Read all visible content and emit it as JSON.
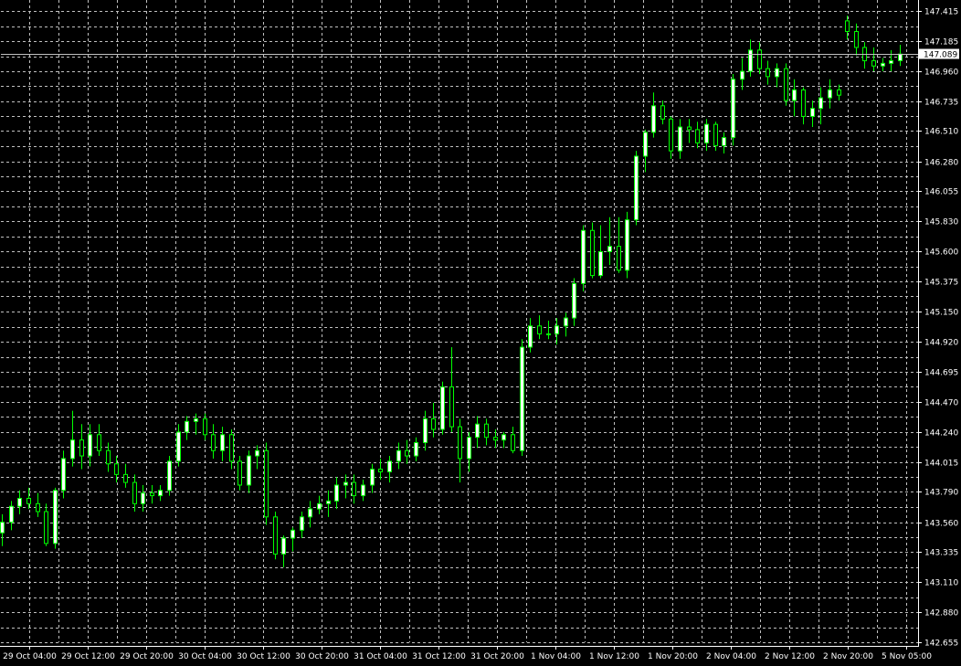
{
  "chart_data": {
    "type": "candlestick",
    "current_price_label": "147.089",
    "current_price": 147.089,
    "ylim": [
      142.655,
      147.415
    ],
    "y_ticks": [
      "147.415",
      "147.185",
      "146.960",
      "146.735",
      "146.510",
      "146.280",
      "146.055",
      "145.830",
      "145.600",
      "145.375",
      "145.150",
      "144.920",
      "144.695",
      "144.470",
      "144.240",
      "144.015",
      "143.790",
      "143.560",
      "143.335",
      "143.110",
      "142.880",
      "142.655"
    ],
    "x_ticks": [
      "29 Oct 04:00",
      "29 Oct 12:00",
      "29 Oct 20:00",
      "30 Oct 04:00",
      "30 Oct 12:00",
      "30 Oct 20:00",
      "31 Oct 04:00",
      "31 Oct 12:00",
      "31 Oct 20:00",
      "1 Nov 04:00",
      "1 Nov 12:00",
      "1 Nov 20:00",
      "2 Nov 04:00",
      "2 Nov 12:00",
      "2 Nov 20:00",
      "5 Nov 05:00"
    ],
    "colors": {
      "bull": "#ffffff",
      "bear": "#000000",
      "wick": "#00ff00",
      "grid": "#c0c0c0",
      "axis": "#ffffff",
      "price_line": "#c0c0c0"
    },
    "grid": true,
    "ohlc": [
      [
        143.48,
        143.62,
        143.38,
        143.56
      ],
      [
        143.56,
        143.72,
        143.5,
        143.68
      ],
      [
        143.68,
        143.8,
        143.62,
        143.74
      ],
      [
        143.74,
        143.82,
        143.66,
        143.7
      ],
      [
        143.7,
        143.78,
        143.6,
        143.64
      ],
      [
        143.64,
        143.7,
        143.38,
        143.4
      ],
      [
        143.4,
        143.82,
        143.36,
        143.8
      ],
      [
        143.8,
        144.1,
        143.74,
        144.04
      ],
      [
        144.04,
        144.4,
        143.98,
        144.18
      ],
      [
        144.18,
        144.3,
        143.96,
        144.06
      ],
      [
        144.06,
        144.3,
        143.98,
        144.22
      ],
      [
        144.22,
        144.3,
        144.06,
        144.1
      ],
      [
        144.1,
        144.16,
        143.94,
        144.0
      ],
      [
        144.0,
        144.06,
        143.86,
        143.92
      ],
      [
        143.92,
        144.0,
        143.82,
        143.86
      ],
      [
        143.86,
        143.92,
        143.64,
        143.7
      ],
      [
        143.7,
        143.84,
        143.64,
        143.78
      ],
      [
        143.78,
        143.84,
        143.7,
        143.76
      ],
      [
        143.76,
        143.84,
        143.72,
        143.8
      ],
      [
        143.8,
        144.06,
        143.76,
        144.02
      ],
      [
        144.02,
        144.3,
        143.98,
        144.24
      ],
      [
        144.24,
        144.36,
        144.18,
        144.32
      ],
      [
        144.32,
        144.38,
        144.22,
        144.34
      ],
      [
        144.34,
        144.38,
        144.18,
        144.22
      ],
      [
        144.22,
        144.3,
        144.04,
        144.1
      ],
      [
        144.1,
        144.28,
        144.02,
        144.22
      ],
      [
        144.22,
        144.26,
        143.96,
        144.02
      ],
      [
        144.02,
        144.06,
        143.8,
        143.84
      ],
      [
        143.84,
        144.1,
        143.78,
        144.06
      ],
      [
        144.06,
        144.14,
        143.96,
        144.1
      ],
      [
        144.1,
        144.16,
        143.54,
        143.6
      ],
      [
        143.6,
        143.64,
        143.28,
        143.32
      ],
      [
        143.32,
        143.46,
        143.22,
        143.44
      ],
      [
        143.44,
        143.52,
        143.34,
        143.5
      ],
      [
        143.5,
        143.64,
        143.44,
        143.6
      ],
      [
        143.6,
        143.72,
        143.52,
        143.66
      ],
      [
        143.66,
        143.76,
        143.62,
        143.7
      ],
      [
        143.7,
        143.8,
        143.6,
        143.72
      ],
      [
        143.72,
        143.9,
        143.66,
        143.84
      ],
      [
        143.84,
        143.92,
        143.74,
        143.86
      ],
      [
        143.86,
        143.92,
        143.7,
        143.76
      ],
      [
        143.76,
        143.88,
        143.72,
        143.84
      ],
      [
        143.84,
        144.0,
        143.78,
        143.96
      ],
      [
        143.96,
        144.04,
        143.88,
        143.94
      ],
      [
        143.94,
        144.06,
        143.86,
        144.02
      ],
      [
        144.02,
        144.16,
        143.96,
        144.1
      ],
      [
        144.1,
        144.18,
        144.0,
        144.06
      ],
      [
        144.06,
        144.2,
        144.02,
        144.16
      ],
      [
        144.16,
        144.4,
        144.1,
        144.34
      ],
      [
        144.34,
        144.46,
        144.2,
        144.26
      ],
      [
        144.26,
        144.62,
        144.22,
        144.58
      ],
      [
        144.58,
        144.88,
        144.24,
        144.28
      ],
      [
        144.28,
        144.34,
        143.86,
        144.04
      ],
      [
        144.04,
        144.24,
        143.94,
        144.2
      ],
      [
        144.2,
        144.36,
        144.12,
        144.3
      ],
      [
        144.3,
        144.34,
        144.14,
        144.2
      ],
      [
        144.2,
        144.26,
        144.12,
        144.18
      ],
      [
        144.18,
        144.24,
        144.12,
        144.22
      ],
      [
        144.22,
        144.28,
        144.08,
        144.1
      ],
      [
        144.1,
        144.94,
        144.06,
        144.88
      ],
      [
        144.88,
        145.1,
        144.84,
        145.04
      ],
      [
        145.04,
        145.12,
        144.94,
        144.98
      ],
      [
        144.98,
        145.08,
        144.94,
        144.98
      ],
      [
        144.98,
        145.1,
        144.9,
        145.04
      ],
      [
        145.04,
        145.14,
        144.96,
        145.1
      ],
      [
        145.1,
        145.4,
        145.04,
        145.36
      ],
      [
        145.36,
        145.8,
        145.3,
        145.76
      ],
      [
        145.76,
        145.82,
        145.4,
        145.42
      ],
      [
        145.42,
        145.8,
        145.4,
        145.6
      ],
      [
        145.6,
        145.86,
        145.5,
        145.64
      ],
      [
        145.64,
        145.86,
        145.44,
        145.46
      ],
      [
        145.46,
        145.9,
        145.4,
        145.84
      ],
      [
        145.84,
        146.36,
        145.8,
        146.32
      ],
      [
        146.32,
        146.52,
        146.2,
        146.5
      ],
      [
        146.5,
        146.8,
        146.46,
        146.7
      ],
      [
        146.7,
        146.74,
        146.56,
        146.6
      ],
      [
        146.6,
        146.62,
        146.3,
        146.36
      ],
      [
        146.36,
        146.6,
        146.3,
        146.54
      ],
      [
        146.54,
        146.6,
        146.42,
        146.52
      ],
      [
        146.52,
        146.58,
        146.38,
        146.42
      ],
      [
        146.42,
        146.6,
        146.36,
        146.56
      ],
      [
        146.56,
        146.58,
        146.36,
        146.4
      ],
      [
        146.4,
        146.5,
        146.34,
        146.46
      ],
      [
        146.46,
        146.94,
        146.4,
        146.9
      ],
      [
        146.9,
        147.06,
        146.82,
        146.96
      ],
      [
        146.96,
        147.2,
        146.92,
        147.12
      ],
      [
        147.12,
        147.18,
        146.94,
        146.98
      ],
      [
        146.98,
        147.04,
        146.86,
        146.92
      ],
      [
        146.92,
        147.02,
        146.84,
        146.98
      ],
      [
        146.98,
        147.02,
        146.7,
        146.74
      ],
      [
        146.74,
        146.9,
        146.62,
        146.82
      ],
      [
        146.82,
        146.84,
        146.56,
        146.62
      ],
      [
        146.62,
        146.74,
        146.54,
        146.68
      ],
      [
        146.68,
        146.84,
        146.56,
        146.76
      ],
      [
        146.76,
        146.9,
        146.68,
        146.82
      ],
      [
        146.82,
        146.86,
        146.74,
        146.78
      ],
      [
        147.34,
        147.38,
        147.2,
        147.26
      ],
      [
        147.26,
        147.32,
        147.08,
        147.14
      ],
      [
        147.14,
        147.18,
        146.98,
        147.04
      ],
      [
        147.04,
        147.14,
        146.96,
        147.0
      ],
      [
        147.0,
        147.06,
        146.96,
        147.02
      ],
      [
        147.02,
        147.12,
        146.96,
        147.04
      ],
      [
        147.04,
        147.16,
        147.0,
        147.09
      ]
    ]
  }
}
